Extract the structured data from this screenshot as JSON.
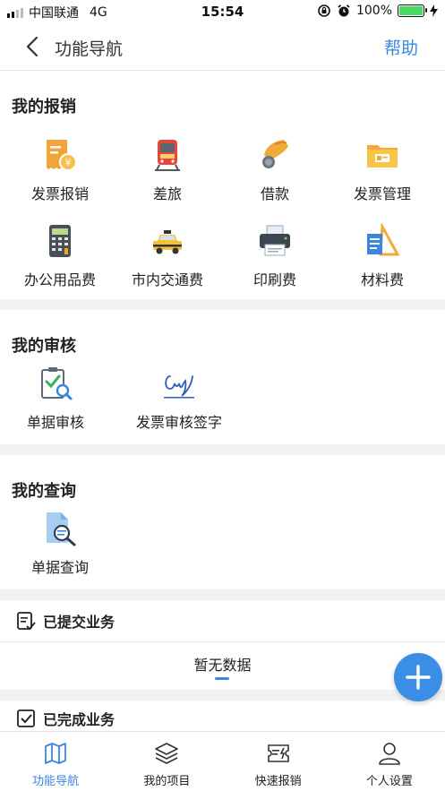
{
  "status_bar": {
    "carrier": "中国联通",
    "network": "4G",
    "time": "15:54",
    "battery": "100%"
  },
  "navbar": {
    "title": "功能导航",
    "help_label": "帮助"
  },
  "sections": {
    "reimburse": {
      "title": "我的报销",
      "items": [
        {
          "label": "发票报销",
          "icon": "invoice-icon"
        },
        {
          "label": "差旅",
          "icon": "train-icon"
        },
        {
          "label": "借款",
          "icon": "loan-hand-icon"
        },
        {
          "label": "发票管理",
          "icon": "folder-icon"
        },
        {
          "label": "办公用品费",
          "icon": "calculator-icon"
        },
        {
          "label": "市内交通费",
          "icon": "taxi-icon"
        },
        {
          "label": "印刷费",
          "icon": "printer-icon"
        },
        {
          "label": "材料费",
          "icon": "materials-icon"
        }
      ]
    },
    "review": {
      "title": "我的审核",
      "items": [
        {
          "label": "单据审核",
          "icon": "clipboard-check-icon"
        },
        {
          "label": "发票审核签字",
          "icon": "signature-icon"
        }
      ]
    },
    "query": {
      "title": "我的查询",
      "items": [
        {
          "label": "单据查询",
          "icon": "document-search-icon"
        }
      ]
    }
  },
  "submitted": {
    "label": "已提交业务",
    "empty_text": "暂无数据"
  },
  "completed": {
    "label": "已完成业务"
  },
  "tabbar": {
    "items": [
      {
        "label": "功能导航",
        "icon": "map-icon",
        "active": true
      },
      {
        "label": "我的项目",
        "icon": "layers-icon",
        "active": false
      },
      {
        "label": "快速报销",
        "icon": "quick-ticket-icon",
        "active": false
      },
      {
        "label": "个人设置",
        "icon": "user-icon",
        "active": false
      }
    ]
  },
  "colors": {
    "accent": "#3a86e0",
    "fab": "#3a8ee6",
    "battery": "#4cd964"
  }
}
